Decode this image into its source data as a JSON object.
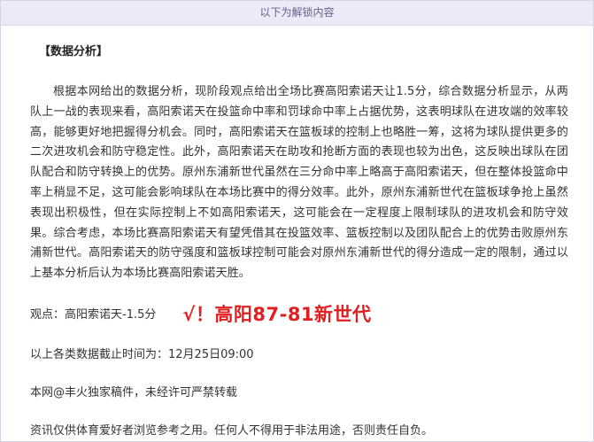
{
  "unlock_bar": {
    "text": "以下为解锁内容"
  },
  "article": {
    "section_title": "【数据分析】",
    "analysis": "根据本网给出的数据分析，现阶段观点给出全场比赛高阳索诺天让1.5分，综合数据分析显示，从两队上一战的表现来看，高阳索诺天在投篮命中率和罚球命中率上占据优势，这表明球队在进攻端的效率较高，能够更好地把握得分机会。同时，高阳索诺天在篮板球的控制上也略胜一筹，这将为球队提供更多的二次进攻机会和防守稳定性。此外，高阳索诺天在助攻和抢断方面的表现也较为出色，这反映出球队在团队配合和防守转换上的优势。原州东浦新世代虽然在三分命中率上略高于高阳索诺天，但在整体投篮命中率上稍显不足，这可能会影响球队在本场比赛中的得分效率。此外，原州东浦新世代在篮板球争抢上虽然表现出积极性，但在实际控制上不如高阳索诺天，这可能会在一定程度上限制球队的进攻机会和防守效果。综合考虑，本场比赛高阳索诺天有望凭借其在投篮效率、篮板控制以及团队配合上的优势击败原州东浦新世代。高阳索诺天的防守强度和篮板球控制可能会对原州东浦新世代的得分造成一定的限制，通过以上基本分析后认为本场比赛高阳索诺天胜。",
    "verdict_label": "观点：高阳索诺天-1.5分",
    "verdict_result": "√！高阳87-81新世代",
    "deadline": "以上各类数据截止时间为：12月25日09:00",
    "copyright": "本网@丰火独家稿件，未经许可严禁转载",
    "disclaimer": "资讯仅供体育爱好者浏览参考之用。任何人不得用于非法用途，否则责任自负。"
  },
  "colors": {
    "verdict_red": "#e02020",
    "bar_background": "#ede9f6"
  }
}
